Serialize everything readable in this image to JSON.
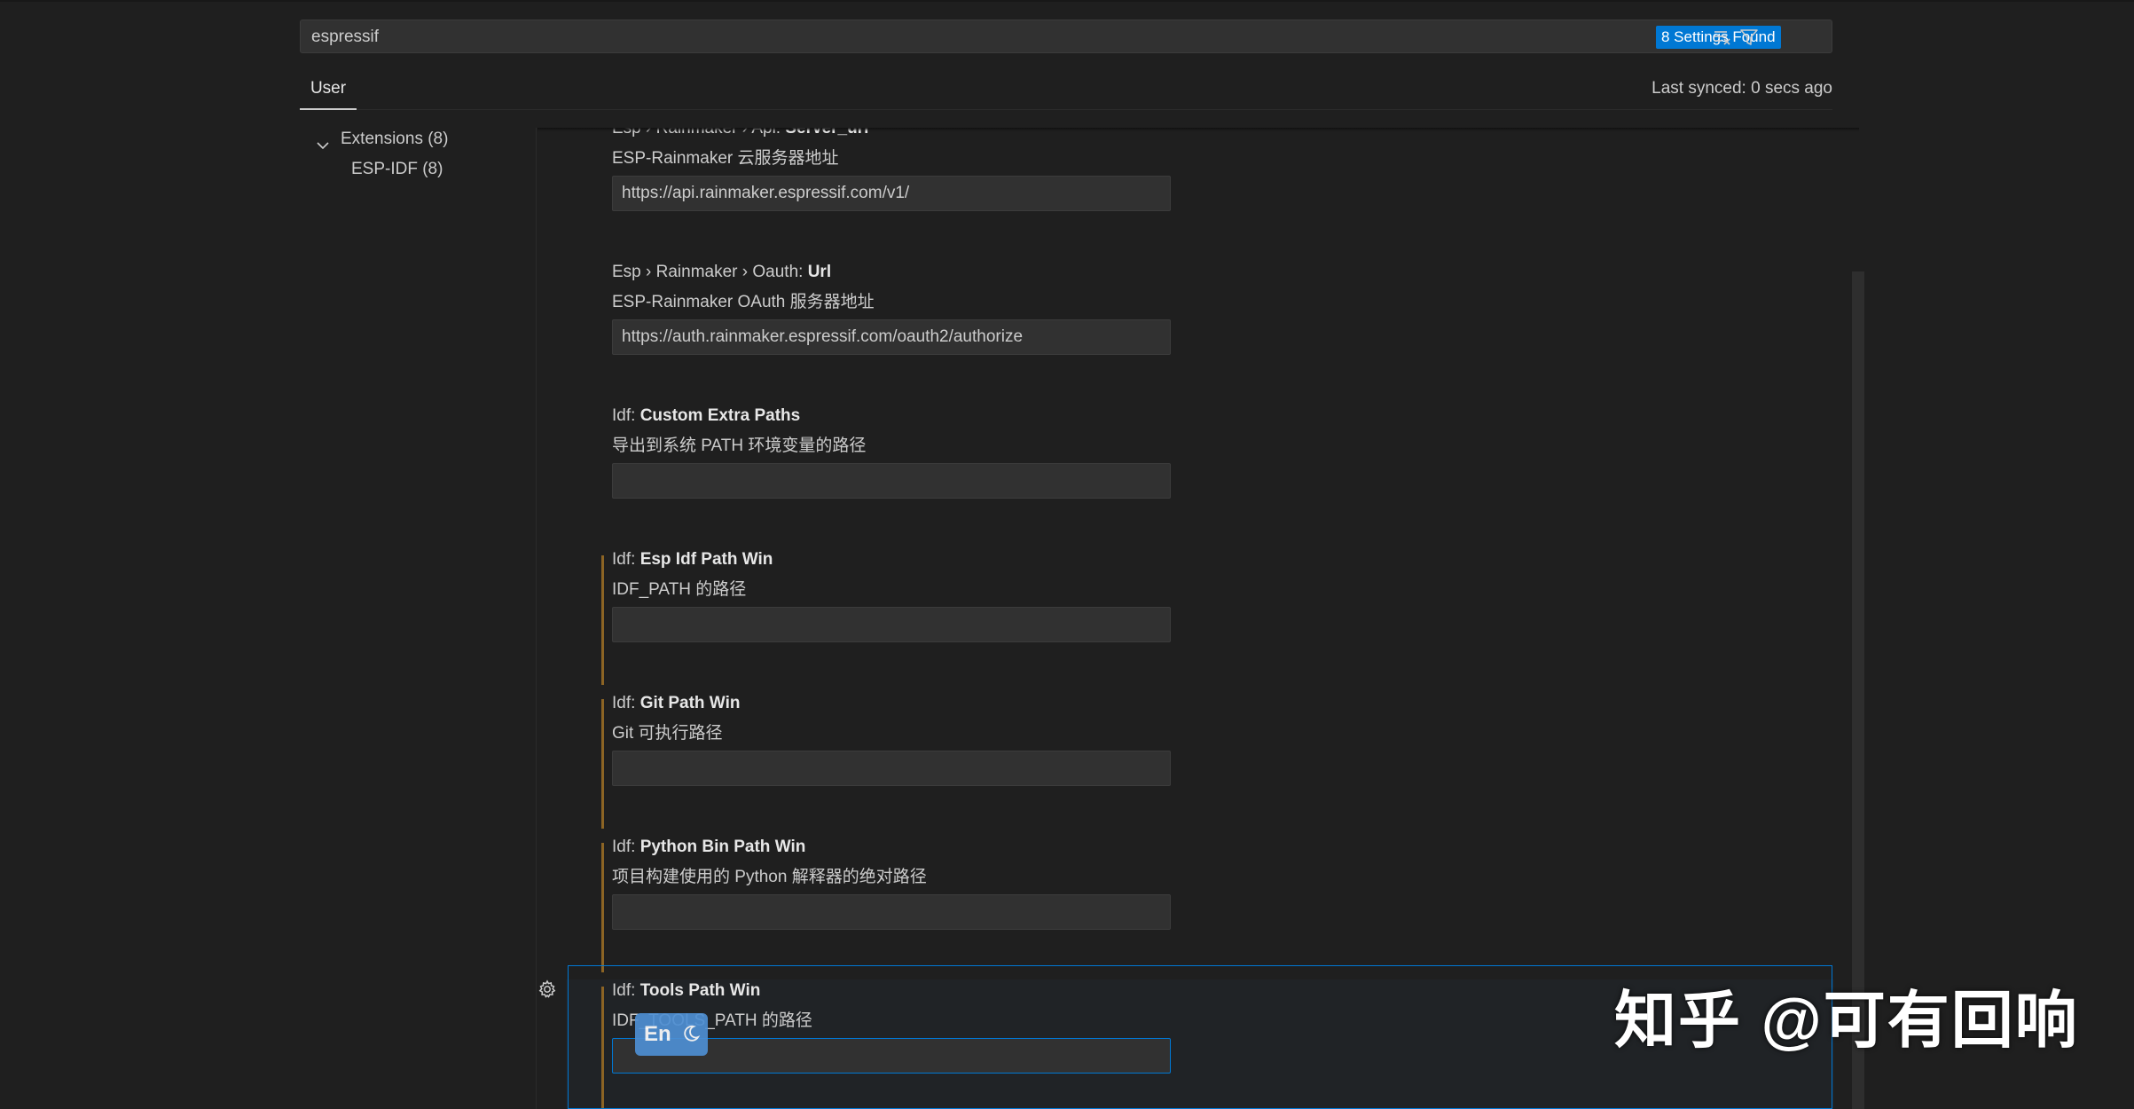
{
  "search": {
    "value": "espressif",
    "results_badge": "8 Settings Found"
  },
  "icons": {
    "clear_filter": "clear-filter-icon",
    "filter": "filter-icon",
    "chevron": "chevron-down-icon",
    "gear": "gear-icon",
    "moon": "moon-icon"
  },
  "tabs": {
    "user": "User",
    "sync_status": "Last synced: 0 secs ago"
  },
  "toc": {
    "group_label": "Extensions (8)",
    "child_label": "ESP-IDF (8)"
  },
  "settings": [
    {
      "category": "Esp › Rainmaker › Api: ",
      "key": "Server_url",
      "description": "ESP-Rainmaker 云服务器地址",
      "value": "https://api.rainmaker.espressif.com/v1/",
      "modified": false
    },
    {
      "category": "Esp › Rainmaker › Oauth: ",
      "key": "Url",
      "description": "ESP-Rainmaker OAuth 服务器地址",
      "value": "https://auth.rainmaker.espressif.com/oauth2/authorize",
      "modified": false
    },
    {
      "category": "Idf: ",
      "key": "Custom Extra Paths",
      "description": "导出到系统 PATH 环境变量的路径",
      "value": "",
      "modified": false
    },
    {
      "category": "Idf: ",
      "key": "Esp Idf Path Win",
      "description": "IDF_PATH 的路径",
      "value": "",
      "modified": true
    },
    {
      "category": "Idf: ",
      "key": "Git Path Win",
      "description": "Git 可执行路径",
      "value": "",
      "modified": true
    },
    {
      "category": "Idf: ",
      "key": "Python Bin Path Win",
      "description": "项目构建使用的 Python 解释器的绝对路径",
      "value": "",
      "modified": true
    },
    {
      "category": "Idf: ",
      "key": "Tools Path Win",
      "description": "IDF_TOOLS_PATH 的路径",
      "value": "",
      "modified": true
    }
  ],
  "ime": {
    "label": "En"
  },
  "watermark": "知乎 @可有回响",
  "colors": {
    "accent": "#0078d4",
    "modified_bar": "#8c6424",
    "background": "#1f1f1f"
  }
}
